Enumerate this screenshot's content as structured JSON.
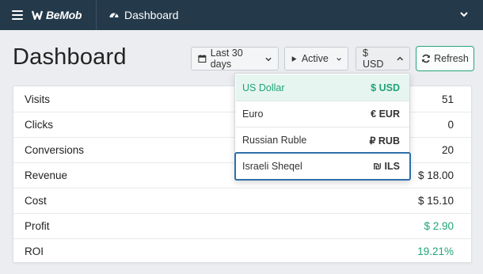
{
  "app": {
    "brand": "BeMob",
    "section": "Dashboard"
  },
  "header": {
    "title": "Dashboard"
  },
  "toolbar": {
    "date_range": "Last 30 days",
    "status": "Active",
    "currency": "$ USD",
    "refresh": "Refresh"
  },
  "stats": [
    {
      "label": "Visits",
      "value": "51"
    },
    {
      "label": "Clicks",
      "value": "0"
    },
    {
      "label": "Conversions",
      "value": "20"
    },
    {
      "label": "Revenue",
      "value": "$ 18.00"
    },
    {
      "label": "Cost",
      "value": "$ 15.10"
    },
    {
      "label": "Profit",
      "value": "$ 2.90"
    },
    {
      "label": "ROI",
      "value": "19.21%"
    }
  ],
  "currency_menu": [
    {
      "name": "US Dollar",
      "code": "$ USD"
    },
    {
      "name": "Euro",
      "code": "€ EUR"
    },
    {
      "name": "Russian Ruble",
      "code": "₽ RUB"
    },
    {
      "name": "Israeli Sheqel",
      "code": "₪ ILS"
    }
  ],
  "colors": {
    "topbar": "#243a4b",
    "accent_green": "#1fa37a",
    "focus_blue": "#2f6ea9"
  },
  "icons": [
    "menu-icon",
    "bemob-logo-icon",
    "dashboard-gauge-icon",
    "chevron-down-icon",
    "calendar-icon",
    "play-icon",
    "chevron-up-icon",
    "refresh-icon"
  ]
}
